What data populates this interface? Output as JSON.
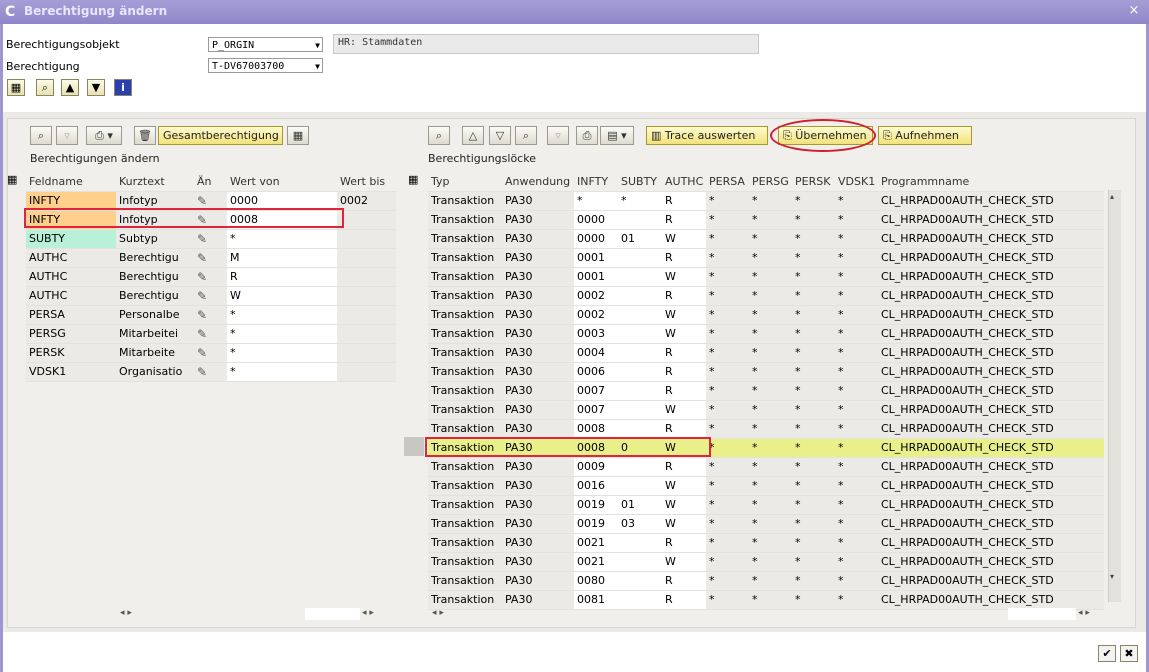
{
  "window": {
    "title": "Berechtigung ändern",
    "close": "×"
  },
  "header": {
    "object_label": "Berechtigungsobjekt",
    "object_value": "P_ORGIN",
    "object_desc": "HR: Stammdaten",
    "auth_label": "Berechtigung",
    "auth_value": "T-DV67003700"
  },
  "top_toolbar": [
    "detail-icon",
    "search-icon",
    "up-icon",
    "down-icon",
    "info-icon"
  ],
  "left_panel": {
    "title": "Berechtigungen ändern",
    "button_full_auth": "Gesamtberechtigung",
    "columns": [
      "Feldname",
      "Kurztext",
      "Än",
      "Wert von",
      "Wert bis"
    ],
    "rows": [
      {
        "field": "INFTY",
        "text": "Infotyp",
        "from": "0000",
        "to": "0002"
      },
      {
        "field": "INFTY",
        "text": "Infotyp",
        "from": "0008",
        "to": ""
      },
      {
        "field": "SUBTY",
        "text": "Subtyp",
        "from": "*",
        "to": ""
      },
      {
        "field": "AUTHC",
        "text": "Berechtigu",
        "from": "M",
        "to": ""
      },
      {
        "field": "AUTHC",
        "text": "Berechtigu",
        "from": "R",
        "to": ""
      },
      {
        "field": "AUTHC",
        "text": "Berechtigu",
        "from": "W",
        "to": ""
      },
      {
        "field": "PERSA",
        "text": "Personalbe",
        "from": "*",
        "to": ""
      },
      {
        "field": "PERSG",
        "text": "Mitarbeitei",
        "from": "*",
        "to": ""
      },
      {
        "field": "PERSK",
        "text": "Mitarbeite",
        "from": "*",
        "to": ""
      },
      {
        "field": "VDSK1",
        "text": "Organisatio",
        "from": "*",
        "to": ""
      }
    ]
  },
  "right_panel": {
    "title": "Berechtigungslöcke",
    "button_trace": "Trace auswerten",
    "button_apply": "Übernehmen",
    "button_collect": "Aufnehmen",
    "columns": [
      "Typ",
      "Anwendung",
      "INFTY",
      "SUBTY",
      "AUTHC",
      "PERSA",
      "PERSG",
      "PERSK",
      "VDSK1",
      "Programmname"
    ],
    "rows": [
      {
        "typ": "Transaktion",
        "app": "PA30",
        "infty": "*",
        "subty": "*",
        "authc": "R",
        "persa": "*",
        "persg": "*",
        "persk": "*",
        "vdsk1": "*",
        "prog": "CL_HRPAD00AUTH_CHECK_STD"
      },
      {
        "typ": "Transaktion",
        "app": "PA30",
        "infty": "0000",
        "subty": "",
        "authc": "R",
        "persa": "*",
        "persg": "*",
        "persk": "*",
        "vdsk1": "*",
        "prog": "CL_HRPAD00AUTH_CHECK_STD"
      },
      {
        "typ": "Transaktion",
        "app": "PA30",
        "infty": "0000",
        "subty": "01",
        "authc": "W",
        "persa": "*",
        "persg": "*",
        "persk": "*",
        "vdsk1": "*",
        "prog": "CL_HRPAD00AUTH_CHECK_STD"
      },
      {
        "typ": "Transaktion",
        "app": "PA30",
        "infty": "0001",
        "subty": "",
        "authc": "R",
        "persa": "*",
        "persg": "*",
        "persk": "*",
        "vdsk1": "*",
        "prog": "CL_HRPAD00AUTH_CHECK_STD"
      },
      {
        "typ": "Transaktion",
        "app": "PA30",
        "infty": "0001",
        "subty": "",
        "authc": "W",
        "persa": "*",
        "persg": "*",
        "persk": "*",
        "vdsk1": "*",
        "prog": "CL_HRPAD00AUTH_CHECK_STD"
      },
      {
        "typ": "Transaktion",
        "app": "PA30",
        "infty": "0002",
        "subty": "",
        "authc": "R",
        "persa": "*",
        "persg": "*",
        "persk": "*",
        "vdsk1": "*",
        "prog": "CL_HRPAD00AUTH_CHECK_STD"
      },
      {
        "typ": "Transaktion",
        "app": "PA30",
        "infty": "0002",
        "subty": "",
        "authc": "W",
        "persa": "*",
        "persg": "*",
        "persk": "*",
        "vdsk1": "*",
        "prog": "CL_HRPAD00AUTH_CHECK_STD"
      },
      {
        "typ": "Transaktion",
        "app": "PA30",
        "infty": "0003",
        "subty": "",
        "authc": "W",
        "persa": "*",
        "persg": "*",
        "persk": "*",
        "vdsk1": "*",
        "prog": "CL_HRPAD00AUTH_CHECK_STD"
      },
      {
        "typ": "Transaktion",
        "app": "PA30",
        "infty": "0004",
        "subty": "",
        "authc": "R",
        "persa": "*",
        "persg": "*",
        "persk": "*",
        "vdsk1": "*",
        "prog": "CL_HRPAD00AUTH_CHECK_STD"
      },
      {
        "typ": "Transaktion",
        "app": "PA30",
        "infty": "0006",
        "subty": "",
        "authc": "R",
        "persa": "*",
        "persg": "*",
        "persk": "*",
        "vdsk1": "*",
        "prog": "CL_HRPAD00AUTH_CHECK_STD"
      },
      {
        "typ": "Transaktion",
        "app": "PA30",
        "infty": "0007",
        "subty": "",
        "authc": "R",
        "persa": "*",
        "persg": "*",
        "persk": "*",
        "vdsk1": "*",
        "prog": "CL_HRPAD00AUTH_CHECK_STD"
      },
      {
        "typ": "Transaktion",
        "app": "PA30",
        "infty": "0007",
        "subty": "",
        "authc": "W",
        "persa": "*",
        "persg": "*",
        "persk": "*",
        "vdsk1": "*",
        "prog": "CL_HRPAD00AUTH_CHECK_STD"
      },
      {
        "typ": "Transaktion",
        "app": "PA30",
        "infty": "0008",
        "subty": "",
        "authc": "R",
        "persa": "*",
        "persg": "*",
        "persk": "*",
        "vdsk1": "*",
        "prog": "CL_HRPAD00AUTH_CHECK_STD"
      },
      {
        "typ": "Transaktion",
        "app": "PA30",
        "infty": "0008",
        "subty": "0",
        "authc": "W",
        "persa": "*",
        "persg": "*",
        "persk": "*",
        "vdsk1": "*",
        "prog": "CL_HRPAD00AUTH_CHECK_STD"
      },
      {
        "typ": "Transaktion",
        "app": "PA30",
        "infty": "0009",
        "subty": "",
        "authc": "R",
        "persa": "*",
        "persg": "*",
        "persk": "*",
        "vdsk1": "*",
        "prog": "CL_HRPAD00AUTH_CHECK_STD"
      },
      {
        "typ": "Transaktion",
        "app": "PA30",
        "infty": "0016",
        "subty": "",
        "authc": "W",
        "persa": "*",
        "persg": "*",
        "persk": "*",
        "vdsk1": "*",
        "prog": "CL_HRPAD00AUTH_CHECK_STD"
      },
      {
        "typ": "Transaktion",
        "app": "PA30",
        "infty": "0019",
        "subty": "01",
        "authc": "W",
        "persa": "*",
        "persg": "*",
        "persk": "*",
        "vdsk1": "*",
        "prog": "CL_HRPAD00AUTH_CHECK_STD"
      },
      {
        "typ": "Transaktion",
        "app": "PA30",
        "infty": "0019",
        "subty": "03",
        "authc": "W",
        "persa": "*",
        "persg": "*",
        "persk": "*",
        "vdsk1": "*",
        "prog": "CL_HRPAD00AUTH_CHECK_STD"
      },
      {
        "typ": "Transaktion",
        "app": "PA30",
        "infty": "0021",
        "subty": "",
        "authc": "R",
        "persa": "*",
        "persg": "*",
        "persk": "*",
        "vdsk1": "*",
        "prog": "CL_HRPAD00AUTH_CHECK_STD"
      },
      {
        "typ": "Transaktion",
        "app": "PA30",
        "infty": "0021",
        "subty": "",
        "authc": "W",
        "persa": "*",
        "persg": "*",
        "persk": "*",
        "vdsk1": "*",
        "prog": "CL_HRPAD00AUTH_CHECK_STD"
      },
      {
        "typ": "Transaktion",
        "app": "PA30",
        "infty": "0080",
        "subty": "",
        "authc": "R",
        "persa": "*",
        "persg": "*",
        "persk": "*",
        "vdsk1": "*",
        "prog": "CL_HRPAD00AUTH_CHECK_STD"
      },
      {
        "typ": "Transaktion",
        "app": "PA30",
        "infty": "0081",
        "subty": "",
        "authc": "R",
        "persa": "*",
        "persg": "*",
        "persk": "*",
        "vdsk1": "*",
        "prog": "CL_HRPAD00AUTH_CHECK_STD"
      }
    ],
    "selected_row": 13
  },
  "footer": {
    "ok_icon": "check-icon",
    "cancel_icon": "cancel-icon"
  },
  "colors": {
    "title_bar": "#9a92d0",
    "selected_row": "#e9f08a",
    "highlight_field": "#ffcf8c",
    "red_mark": "#e0243a"
  }
}
